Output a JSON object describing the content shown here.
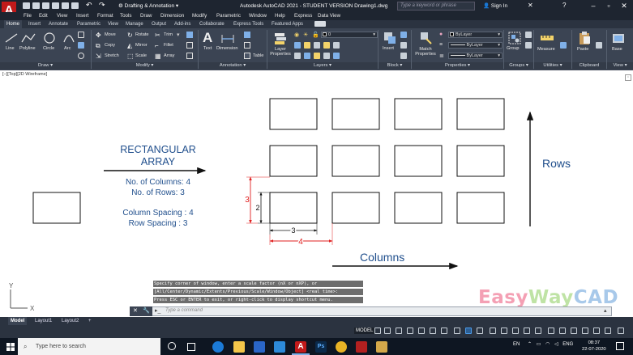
{
  "app": {
    "logo_letter": "A",
    "workspace": "Drafting & Annotation",
    "title": "Autodesk AutoCAD 2021 - STUDENT VERSION   Drawing1.dwg",
    "search_placeholder": "Type a keyword or phrase",
    "signin": "Sign In"
  },
  "menu": [
    "File",
    "Edit",
    "View",
    "Insert",
    "Format",
    "Tools",
    "Draw",
    "Dimension",
    "Modify",
    "Parametric",
    "Window",
    "Help",
    "Express",
    "Data View"
  ],
  "ribbon_tabs": [
    "Home",
    "Insert",
    "Annotate",
    "Parametric",
    "View",
    "Manage",
    "Output",
    "Add-ins",
    "Collaborate",
    "Express Tools",
    "Featured Apps"
  ],
  "ribbon": {
    "draw": {
      "line": "Line",
      "polyline": "Polyline",
      "circle": "Circle",
      "arc": "Arc",
      "footer": "Draw ▾"
    },
    "modify": {
      "move": "Move",
      "rotate": "Rotate",
      "trim": "Trim",
      "copy": "Copy",
      "mirror": "Mirror",
      "fillet": "Fillet",
      "stretch": "Stretch",
      "scale": "Scale",
      "array": "Array",
      "footer": "Modify ▾"
    },
    "annotation": {
      "text": "Text",
      "dimension": "Dimension",
      "table": "Table",
      "footer": "Annotation ▾"
    },
    "layers": {
      "layer_properties": "Layer Properties",
      "layer_value": "0",
      "footer": "Layers ▾"
    },
    "block": {
      "insert": "Insert",
      "footer": "Block ▾"
    },
    "properties": {
      "match": "Match Properties",
      "color": "ByLayer",
      "linetype": "ByLayer",
      "lineweight": "ByLayer",
      "footer": "Properties ▾"
    },
    "groups": {
      "group": "Group",
      "footer": "Groups ▾"
    },
    "utilities": {
      "measure": "Measure",
      "footer": "Utilities ▾"
    },
    "clipboard": {
      "paste": "Paste",
      "footer": "Clipboard"
    },
    "view": {
      "base": "Base",
      "footer": "View ▾"
    }
  },
  "viewport_label": "[−][Top][2D Wireframe]",
  "drawing": {
    "heading_line1": "RECTANGULAR",
    "heading_line2": "ARRAY",
    "columns_text": "No. of Columns: 4",
    "rows_text": "No. of Rows: 3",
    "col_spacing_text": "Column Spacing : 4",
    "row_spacing_text": "Row Spacing : 3",
    "rows_label": "Rows",
    "columns_label": "Columns",
    "dim_width": "3",
    "dim_col_spacing": "4",
    "dim_height": "2",
    "dim_row_spacing": "3",
    "ucs_x": "X",
    "ucs_y": "Y"
  },
  "command": {
    "history": [
      "Specify corner of window, enter a scale factor (nX or nXP), or",
      "[All/Center/Dynamic/Extents/Previous/Scale/Window/Object] <real time>:",
      "Press ESC or ENTER to exit, or right-click to display shortcut menu."
    ],
    "prompt": "Type a command"
  },
  "watermark": {
    "easy": "Easy",
    "way": "Way",
    "cad": "CAD",
    "colors": {
      "easy": "#f4a0b4",
      "way": "#bfe3a5",
      "cad": "#a8c9ea"
    }
  },
  "layout_tabs": [
    "Model",
    "Layout1",
    "Layout2",
    "+"
  ],
  "status": {
    "model": "MODEL"
  },
  "taskbar": {
    "search_placeholder": "Type here to search",
    "tray_lang": "EN",
    "tray_kbd": "ENG",
    "time": "08:37",
    "date": "22-07-2020"
  },
  "colors": {
    "accent": "#1f4e8c",
    "dimension_red": "#e02020"
  }
}
